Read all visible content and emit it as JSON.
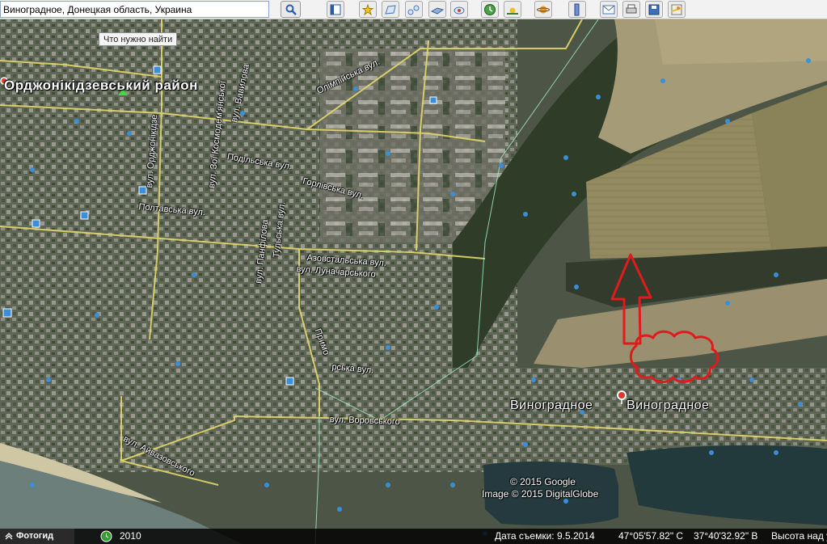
{
  "search": {
    "value": "Виноградное, Донецкая область, Украина"
  },
  "tooltip": "Что нужно найти",
  "toolbar_icons": [
    "sidebar-icon",
    "placemark-icon",
    "polygon-icon",
    "path-icon",
    "image-overlay-icon",
    "record-tour-icon",
    "historical-imagery-icon",
    "sunlight-icon",
    "planets-icon",
    "ruler-icon",
    "email-icon",
    "print-icon",
    "save-image-icon",
    "google-maps-icon"
  ],
  "labels": {
    "district": "Орджонікідзевський район",
    "olimpiyska": "Олімпійська вул.",
    "vavilova": "вул. Вавилова",
    "kosmodem": "вул. Зої Космодем'янської",
    "ordzhon": "вул. Орджонікідзе",
    "podilska": "Подільська вул.",
    "gorlivska": "Горлівська вул.",
    "poltavska": "Полтавська вул.",
    "tulska": "Тульська вул.",
    "panfilova": "вул. Панфілова",
    "azovstal": "Азовстальська вул.",
    "lunach": "вул. Луначарського",
    "prymorska1": "Примо",
    "prymorska2": "рська вул.",
    "vorovskogo": "вул. Воровського",
    "aivaz": "вул. Айвазовського",
    "vinogradnoe1": "Виноградное",
    "vinogradnoe2": "Виноградное",
    "copyright1": "© 2015 Google",
    "copyright2": "Image © 2015 DigitalGlobe"
  },
  "status": {
    "tour": "Фотогид",
    "year": "2010",
    "date": "Дата съемки: 9.5.2014",
    "lat": "47°05'57.82\" С",
    "lon": "37°40'32.92\" В",
    "alt": "Высота над у"
  },
  "colors": {
    "road": "#e3d86a",
    "boundary": "#9fe8c8",
    "annotation": "#e01b1b",
    "pin": "#3a8fd8"
  }
}
